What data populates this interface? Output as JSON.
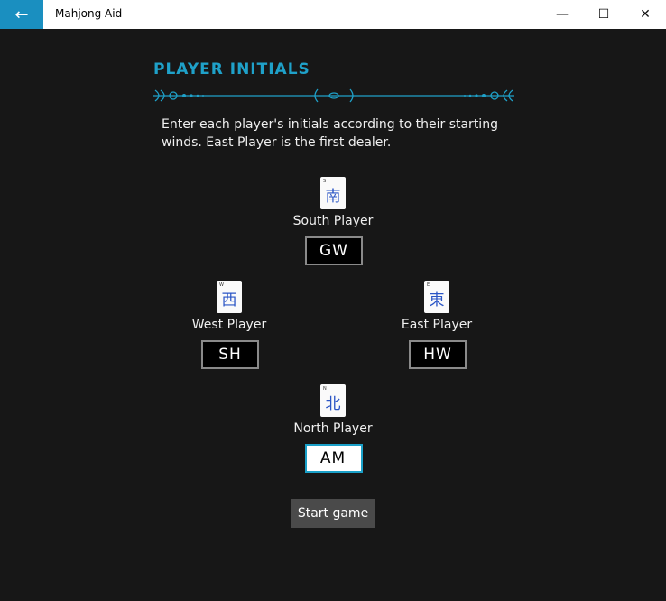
{
  "window": {
    "title": "Mahjong Aid",
    "back_icon": "←",
    "minimize_icon": "—",
    "maximize_icon": "☐",
    "close_icon": "✕"
  },
  "page": {
    "section_title": "PLAYER INITIALS",
    "instructions": "Enter each player's initials according to their starting winds. East Player is the first dealer.",
    "accent_color": "#1fa1c9"
  },
  "players": {
    "south": {
      "label": "South Player",
      "initials": "GW",
      "tile_glyph": "南",
      "tile_corner": "S"
    },
    "west": {
      "label": "West Player",
      "initials": "SH",
      "tile_glyph": "西",
      "tile_corner": "W"
    },
    "east": {
      "label": "East Player",
      "initials": "HW",
      "tile_glyph": "東",
      "tile_corner": "E"
    },
    "north": {
      "label": "North Player",
      "initials": "AM",
      "tile_glyph": "北",
      "tile_corner": "N"
    }
  },
  "actions": {
    "start_label": "Start game"
  }
}
